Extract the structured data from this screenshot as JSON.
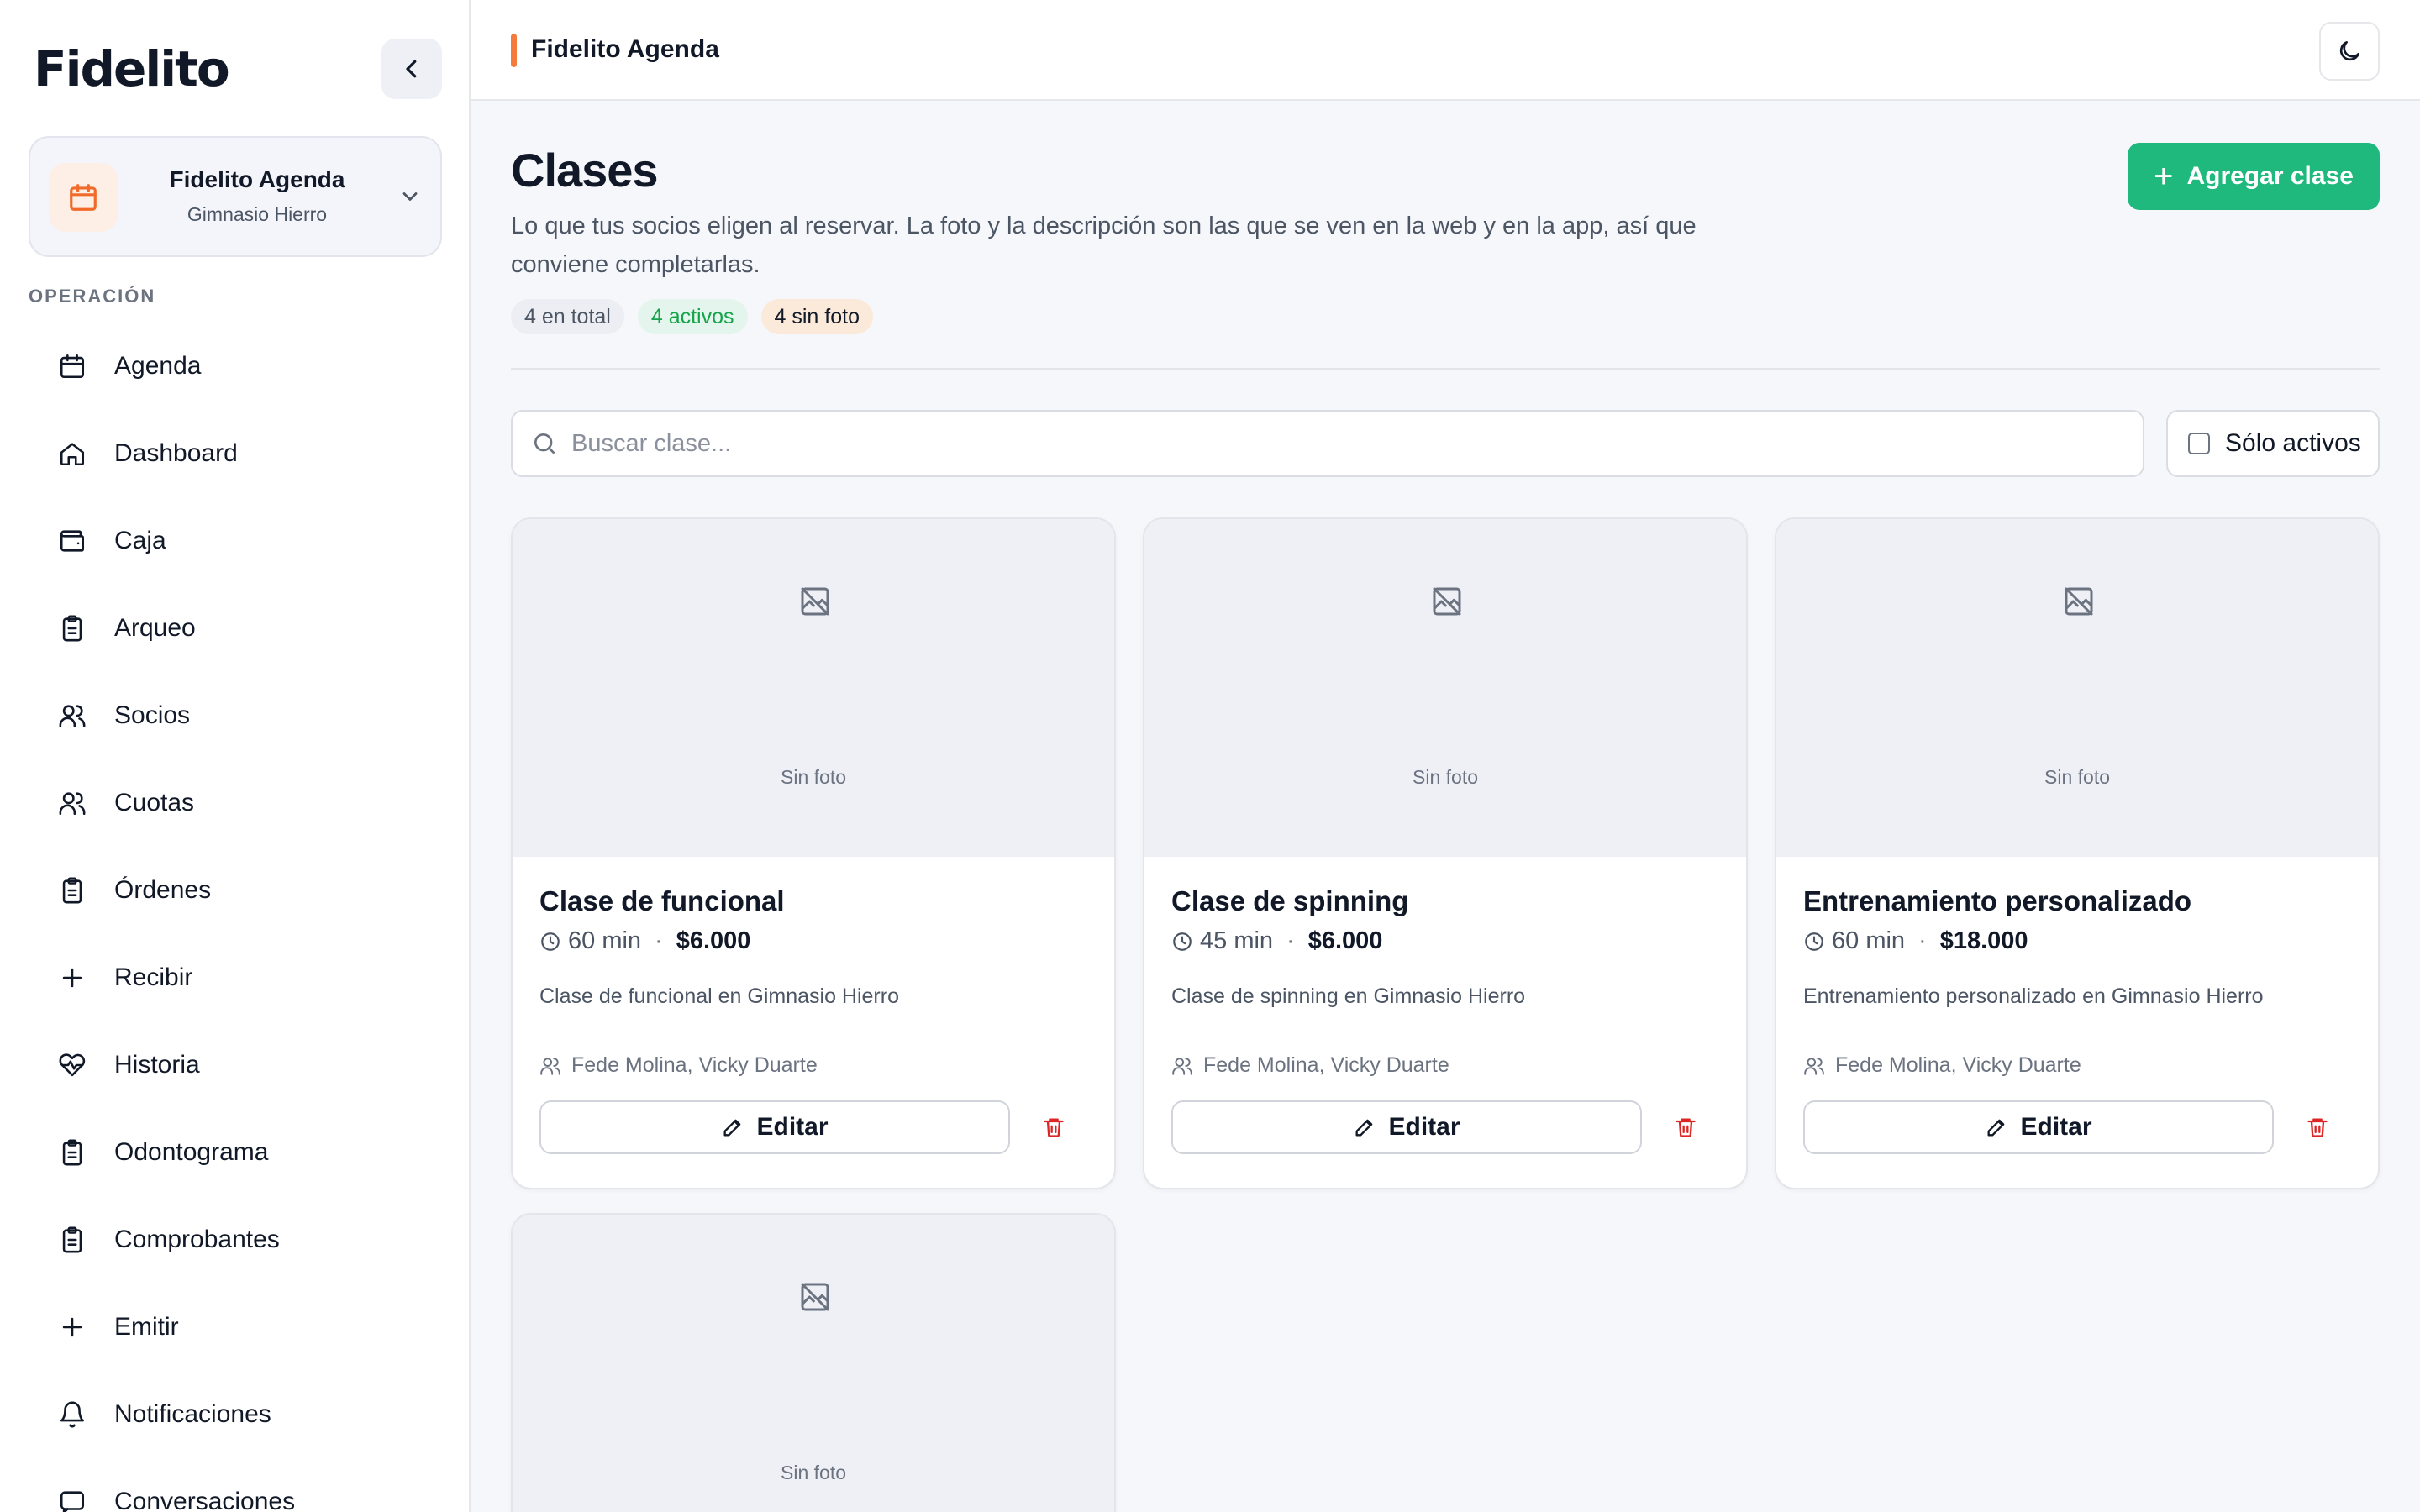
{
  "app": {
    "logo": "Fidelito",
    "header_title": "Fidelito Agenda"
  },
  "sidebar": {
    "org": {
      "name": "Fidelito Agenda",
      "subtitle": "Gimnasio Hierro"
    },
    "section_label": "OPERACIÓN",
    "items": [
      {
        "label": "Agenda",
        "icon": "calendar-icon"
      },
      {
        "label": "Dashboard",
        "icon": "home-icon"
      },
      {
        "label": "Caja",
        "icon": "wallet-icon"
      },
      {
        "label": "Arqueo",
        "icon": "clipboard-icon"
      },
      {
        "label": "Socios",
        "icon": "users-icon"
      },
      {
        "label": "Cuotas",
        "icon": "users-icon"
      },
      {
        "label": "Órdenes",
        "icon": "clipboard-icon"
      },
      {
        "label": "Recibir",
        "icon": "plus-icon"
      },
      {
        "label": "Historia",
        "icon": "heart-pulse-icon"
      },
      {
        "label": "Odontograma",
        "icon": "clipboard-icon"
      },
      {
        "label": "Comprobantes",
        "icon": "clipboard-icon"
      },
      {
        "label": "Emitir",
        "icon": "plus-icon"
      },
      {
        "label": "Notificaciones",
        "icon": "bell-icon"
      },
      {
        "label": "Conversaciones",
        "icon": "chat-icon"
      }
    ]
  },
  "page": {
    "title": "Clases",
    "description": "Lo que tus socios eligen al reservar. La foto y la descripción son las que se ven en la web y en la app, así que conviene completarlas.",
    "add_button": "Agregar clase",
    "badges": {
      "total": "4 en total",
      "active": "4 activos",
      "no_photo": "4 sin foto"
    },
    "search_placeholder": "Buscar clase...",
    "filter_label": "Sólo activos"
  },
  "cards": [
    {
      "photo_label": "Sin foto",
      "title": "Clase de funcional",
      "duration": "60 min",
      "price": "$6.000",
      "description": "Clase de funcional en Gimnasio Hierro",
      "staff": "Fede Molina, Vicky Duarte",
      "edit_label": "Editar"
    },
    {
      "photo_label": "Sin foto",
      "title": "Clase de spinning",
      "duration": "45 min",
      "price": "$6.000",
      "description": "Clase de spinning en Gimnasio Hierro",
      "staff": "Fede Molina, Vicky Duarte",
      "edit_label": "Editar"
    },
    {
      "photo_label": "Sin foto",
      "title": "Entrenamiento personalizado",
      "duration": "60 min",
      "price": "$18.000",
      "description": "Entrenamiento personalizado en Gimnasio Hierro",
      "staff": "Fede Molina, Vicky Duarte",
      "edit_label": "Editar"
    },
    {
      "photo_label": "Sin foto"
    }
  ],
  "colors": {
    "accent": "#f47b3c",
    "primary": "#1fb87d",
    "danger": "#dc2626"
  }
}
